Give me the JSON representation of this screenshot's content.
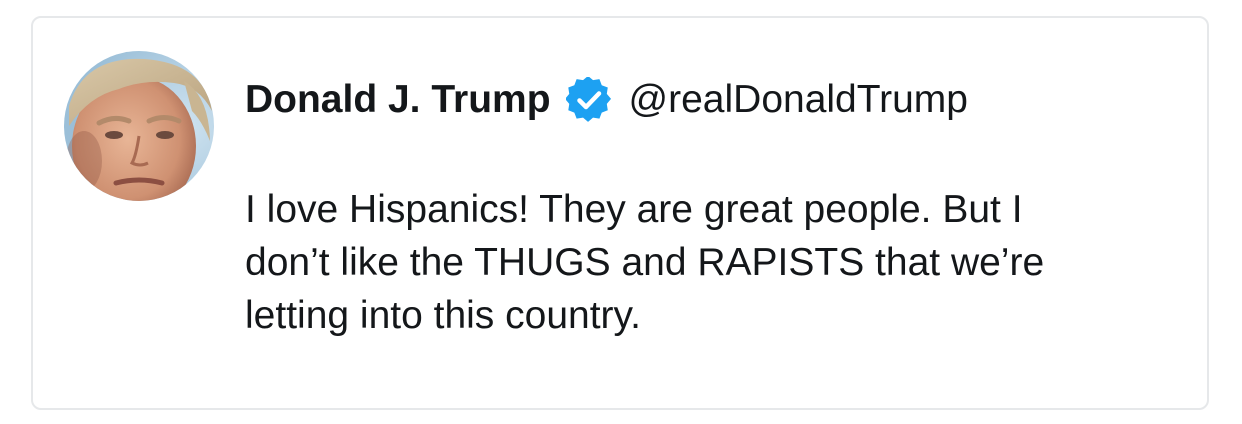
{
  "tweet": {
    "author": {
      "display_name": "Donald J. Trump",
      "handle": "@realDonaldTrump",
      "verified": true,
      "avatar_icon": "portrait-avatar"
    },
    "text_lines": [
      "I love Hispanics! They are great people. But I",
      "don’t like the THUGS and RAPISTS that we’re",
      "letting into this country."
    ]
  },
  "colors": {
    "verified_badge": "#1da1f2",
    "text": "#14171a",
    "card_border": "#e6e8ea",
    "background": "#ffffff"
  }
}
